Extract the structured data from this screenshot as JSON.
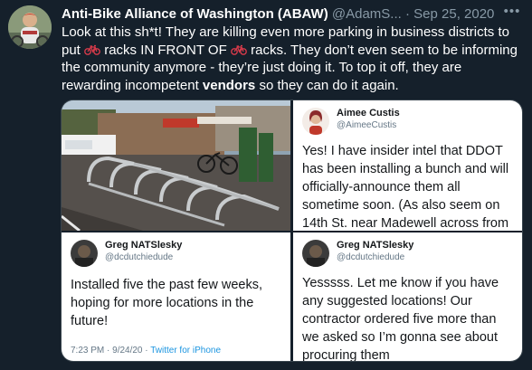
{
  "tweet": {
    "display_name": "Anti-Bike Alliance of Washington (ABAW)",
    "handle": "@AdamS...",
    "separator": "·",
    "date": "Sep 25, 2020",
    "body": {
      "p1": "Look at this sh*t! They are killing even more parking in business districts to put ",
      "p2": " racks IN FRONT OF ",
      "p3": " racks. They don’t even seem to be informing the community anymore - they’re just doing it. To top it off, they are rewarding incompetent ",
      "bold": "vendors",
      "p4": " so they can do it again."
    }
  },
  "media": {
    "top_right": {
      "name": "Aimee Custis",
      "handle": "@AimeeCustis",
      "text": "Yes! I have insider intel that DDOT has been installing a bunch and will officially-announce them all sometime soon. (As also seem on 14th St. near Madewell across from"
    },
    "bottom_left": {
      "name": "Greg NATSlesky",
      "handle": "@dcdutchiedude",
      "text": "Installed five the past few weeks, hoping for more locations in the future!",
      "time": "7:23 PM · 9/24/20 · ",
      "client": "Twitter for iPhone"
    },
    "bottom_right": {
      "name": "Greg NATSlesky",
      "handle": "@dcdutchiedude",
      "text": "Yesssss. Let me know if you have any suggested locations! Our contractor ordered five more than we asked so I’m gonna see about procuring them"
    }
  },
  "icons": {
    "more": "more-icon",
    "bike": "bicycle-emoji"
  },
  "colors": {
    "background": "#15202b",
    "secondary_text": "#8899a6",
    "link": "#1b95e0"
  }
}
